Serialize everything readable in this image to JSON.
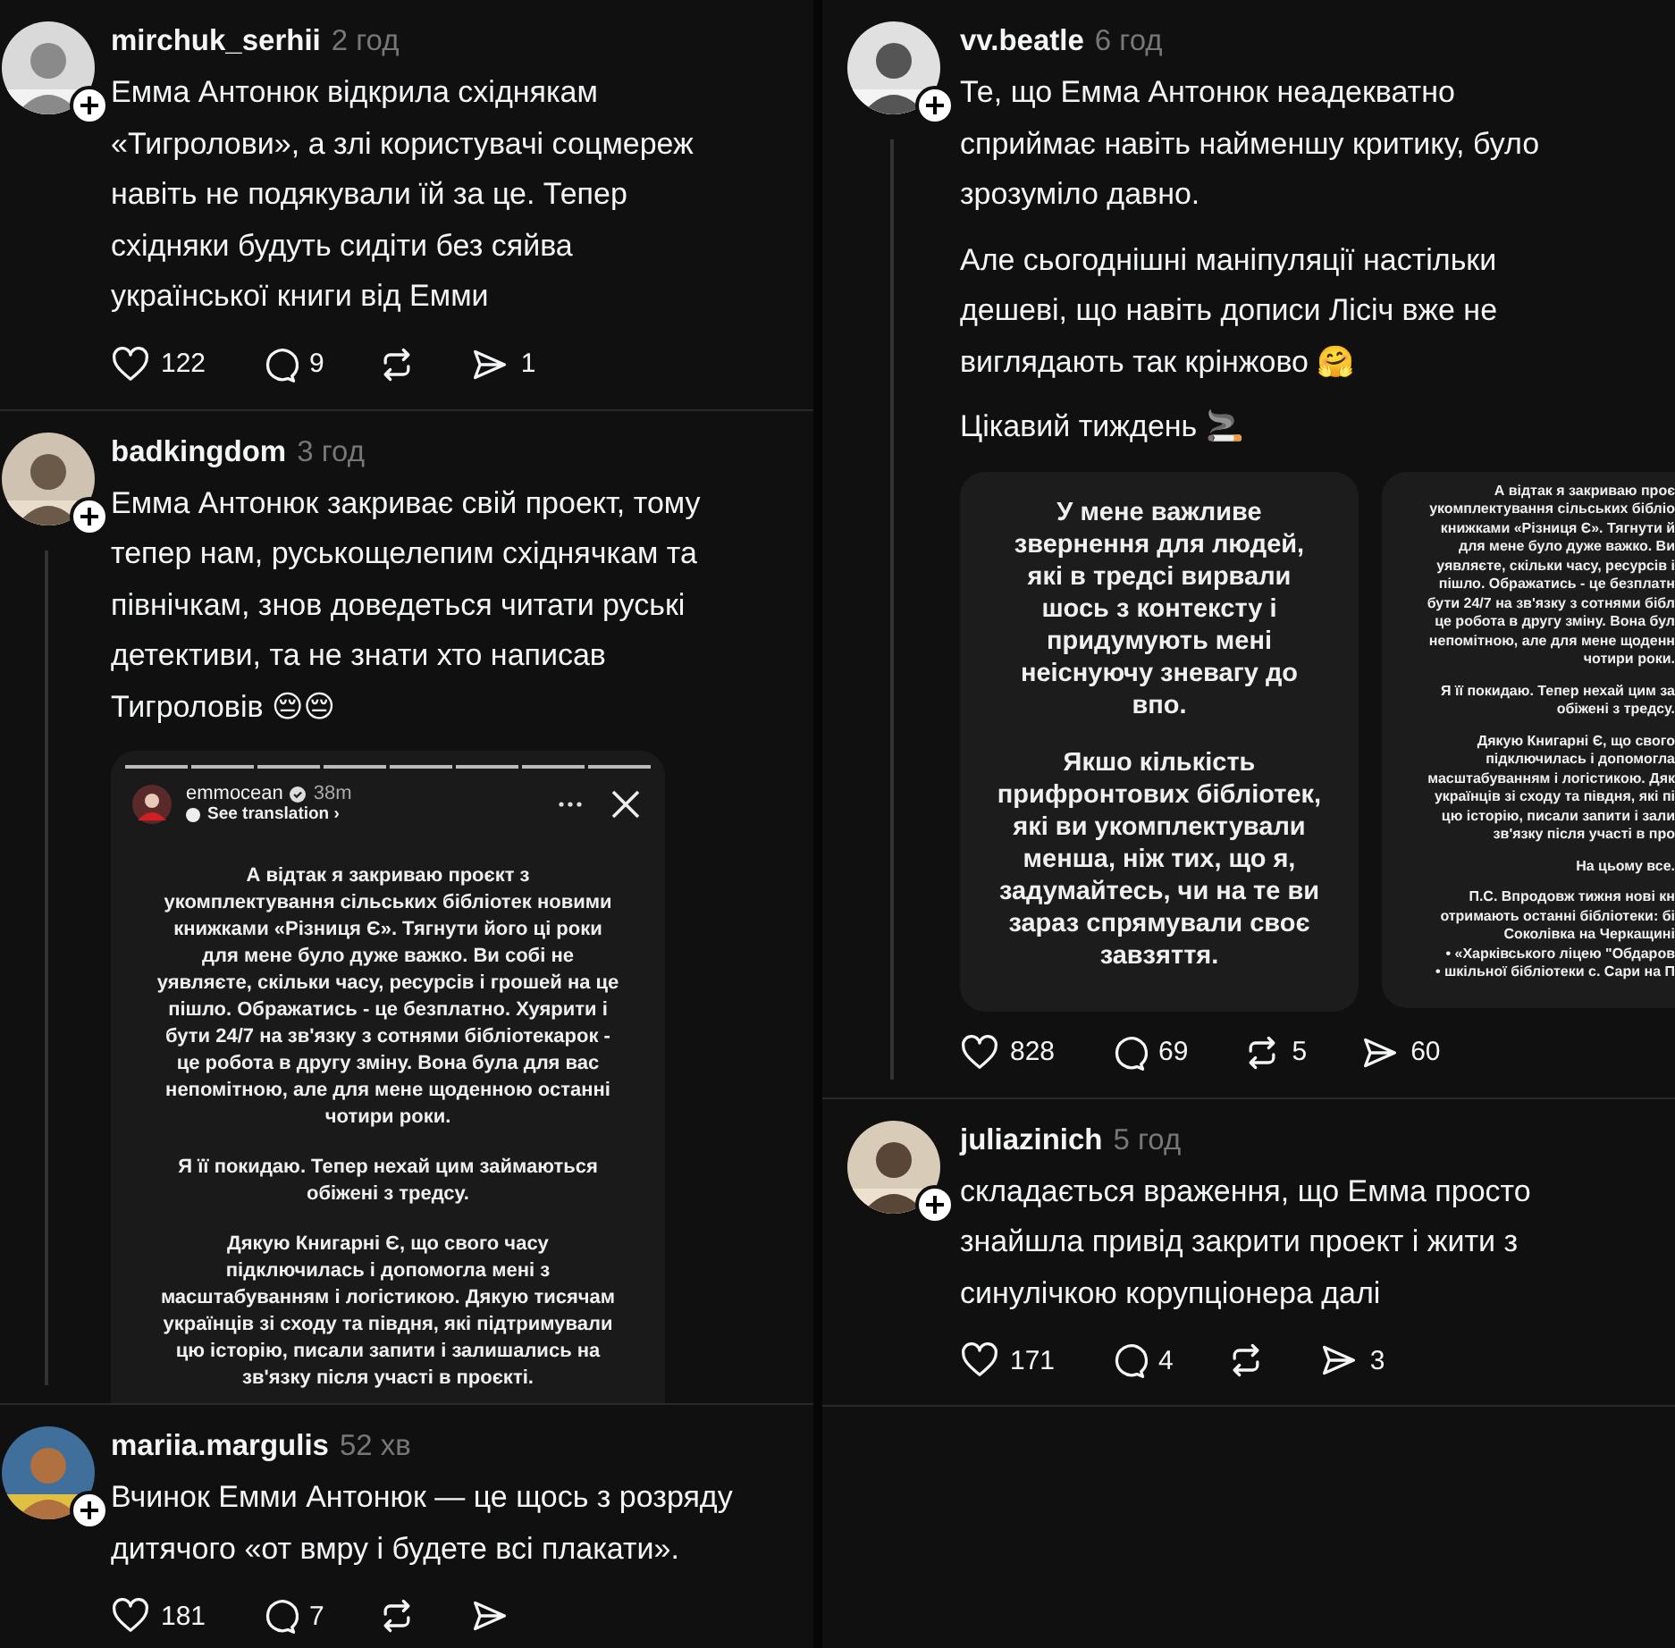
{
  "columns": [
    {
      "posts": [
        {
          "username": "mirchuk_serhii",
          "time": "2 год",
          "thread_line": false,
          "paragraphs": [
            "Емма Антонюк відкрила східнякам «Тигролови», а злі користувачі соцмереж навіть не подякували їй за це. Тепер східняки будуть сидіти без сяйва української книги від Емми"
          ],
          "likes": "122",
          "replies": "9",
          "shares": "1"
        },
        {
          "username": "badkingdom",
          "time": "3 год",
          "thread_line": true,
          "paragraphs": [
            "Емма Антонюк закриває свій проект, тому тепер нам, руськощелепим східнячкам та північкам, знов доведеться читати руські детективи, та не знати хто написав Тигроловів 😔😔"
          ],
          "media": [
            {
              "kind": "header_story",
              "account": "emmocean",
              "age": "38m",
              "translate": "See translation ›",
              "paragraphs": [
                "А відтак я закриваю проєкт з\nукомплектування сільських бібліотек новими\nкнижками «Різниця Є». Тягнути його ці роки\nдля мене було дуже важко. Ви собі не\nуявляєте, скільки часу, ресурсів і грошей на це\nпішло. Ображатись - це безплатно. Хуярити і\nбути 24/7 на зв'язку з сотнями бібліотекарок -\nце робота в другу зміну. Вона була для вас\nнепомітною, але для мене щоденною останні\nчотири роки.",
                "Я її покидаю. Тепер нехай цим займаються\nобіжені з тредсу.",
                "Дякую Книгарні Є, що свого часу\nпідключилась і допомогла мені з\nмасштабуванням і логістикою. Дякую тисячам\nукраїнців зі сходу та півдня, які підтримували\nцю історію, писали запити і залишались на\nзв'язку після участі в проєкті."
              ]
            }
          ]
        },
        {
          "username": "mariia.margulis",
          "time": "52 хв",
          "thread_line": false,
          "paragraphs": [
            "Вчинок Емми Антонюк — це щось з розряду дитячого «от вмру і будете всі плакати»."
          ],
          "likes": "181",
          "replies": "7"
        }
      ]
    },
    {
      "posts": [
        {
          "username": "vv.beatle",
          "time": "6 год",
          "thread_line": true,
          "paragraphs": [
            "Те, що Емма Антонюк неадекватно сприймає навіть найменшу критику, було зрозуміло давно.",
            "Але сьогоднішні маніпуляції настільки дешеві, що навіть дописи Лісіч вже не виглядають так крінжово 🤗",
            "Цікавий тиждень 🚬"
          ],
          "media": [
            {
              "kind": "large_text",
              "paragraphs": [
                "У мене важливе\nзвернення для людей,\nякі в тредсі вирвали\nшось з контексту і\nпридумують мені\nнеіснуючу зневагу до\nвпо.",
                "Якшо кількість\nприфронтових бібліотек,\nякі ви укомплектували\nменша, ніж тих, що я,\nзадумайтесь, чи на те ви\nзараз спрямували своє\nзавзяття."
              ]
            },
            {
              "kind": "small_text",
              "paragraphs": [
                "А відтак я закриваю проє\nукомплектування сільських бібліо\nкнижками «Різниця Є». Тягнути й\nдля мене було дуже важко. Ви\nуявляєте, скільки часу, ресурсів і\nпішло. Ображатись - це безплатн\nбути 24/7 на зв'язку з сотнями бібл\nце робота в другу зміну. Вона бул\nнепомітною, але для мене щоденн\nчотири роки.",
                "Я її покидаю. Тепер нехай цим за\nобіжені з тредсу.",
                "Дякую Книгарні Є, що свого\nпідключилась і допомогла\nмасштабуванням і логістикою. Дяк\nукраїнців зі сходу та півдня, які пі\nцю історію, писали запити і зали\nзв'язку після участі в про",
                "На цьому все.",
                "П.С. Впродовж тижня нові кн\nотримають останні бібліотеки: бі\nСоколівка на Черкащині\n• «Харківського ліцею \"Обдаров\n• шкільної бібліотеки с. Сари на П"
              ]
            }
          ],
          "likes": "828",
          "replies": "69",
          "reposts": "5",
          "shares": "60"
        },
        {
          "username": "juliazinich",
          "time": "5 год",
          "thread_line": false,
          "paragraphs": [
            "складається враження, що Емма просто знайшла привід закрити проект і жити з синулічкою корупціонера далі"
          ],
          "likes": "171",
          "replies": "4",
          "shares": "3"
        }
      ]
    }
  ]
}
